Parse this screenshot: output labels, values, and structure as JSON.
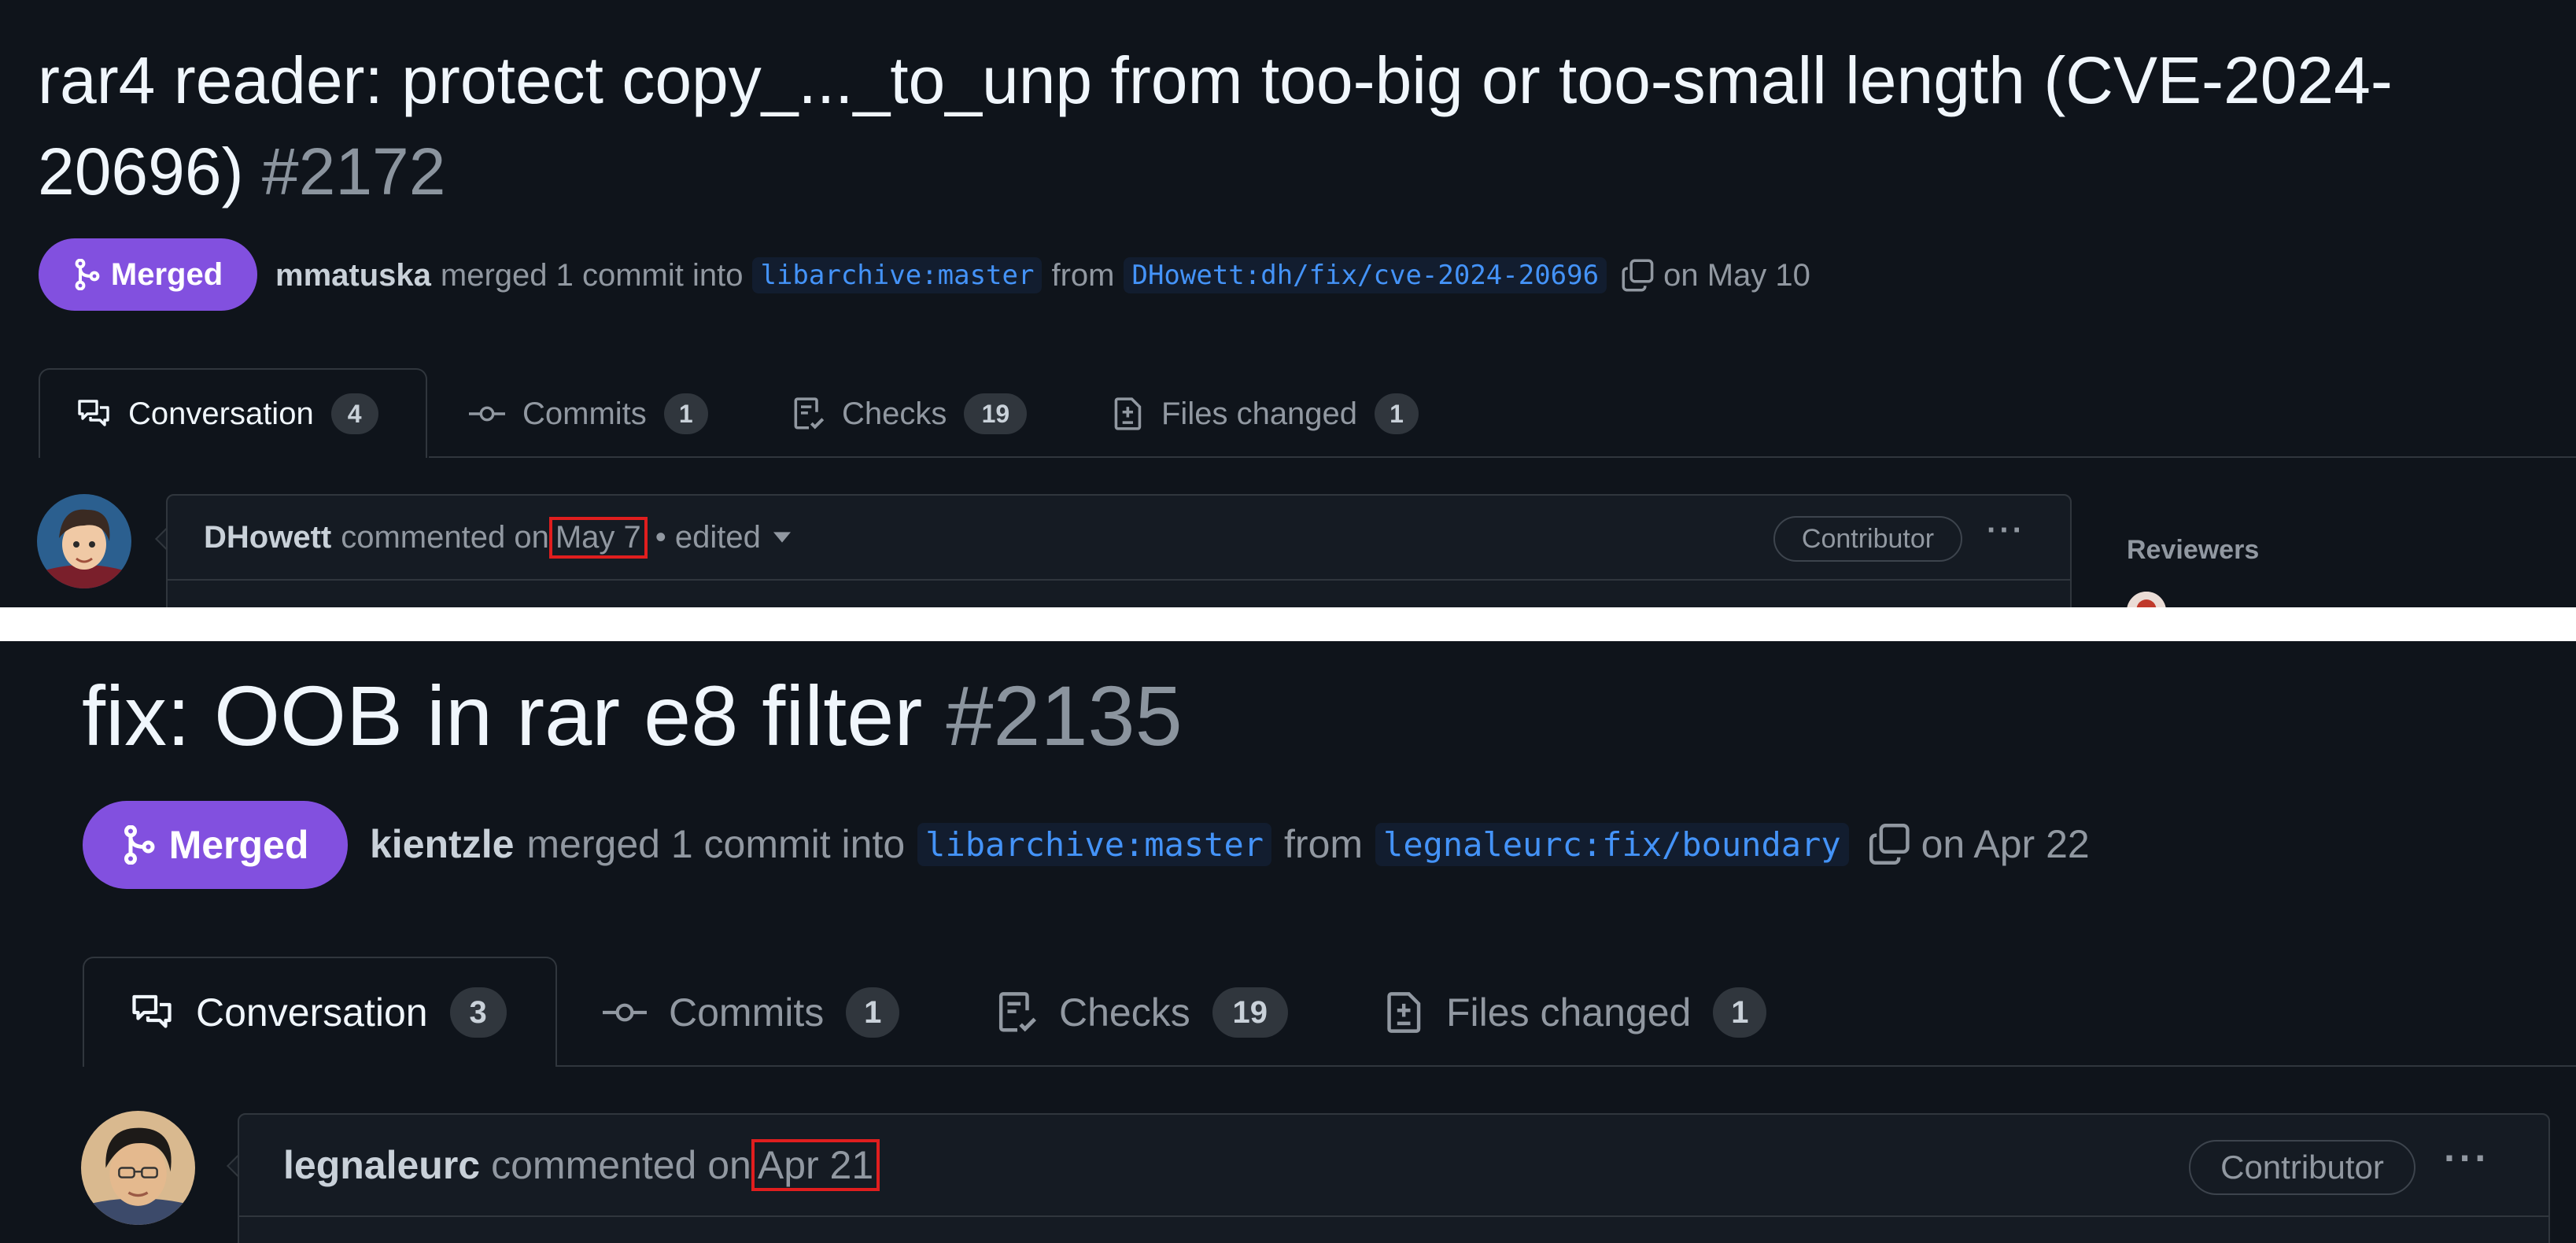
{
  "pr1": {
    "title_line1": "rar4 reader: protect copy_..._to_unp from too-big or too-small length (CVE-2024-",
    "title_line2": "20696)",
    "number": "#2172",
    "state": "Merged",
    "merger": "mmatuska",
    "merge_text": "merged 1 commit into",
    "base_branch": "libarchive:master",
    "from_text": "from",
    "head_branch": "DHowett:dh/fix/cve-2024-20696",
    "date": "on May 10",
    "tabs": [
      {
        "label": "Conversation",
        "count": "4"
      },
      {
        "label": "Commits",
        "count": "1"
      },
      {
        "label": "Checks",
        "count": "19"
      },
      {
        "label": "Files changed",
        "count": "1"
      }
    ],
    "comment": {
      "author": "DHowett",
      "action": "commented on",
      "date": "May 7",
      "edited": "• edited",
      "role": "Contributor",
      "more": "···"
    },
    "sidebar": {
      "reviewers_label": "Reviewers"
    }
  },
  "pr2": {
    "title": "fix: OOB in rar e8 filter",
    "number": "#2135",
    "state": "Merged",
    "merger": "kientzle",
    "merge_text": "merged 1 commit into",
    "base_branch": "libarchive:master",
    "from_text": "from",
    "head_branch": "legnaleurc:fix/boundary",
    "date": "on Apr 22",
    "tabs": [
      {
        "label": "Conversation",
        "count": "3"
      },
      {
        "label": "Commits",
        "count": "1"
      },
      {
        "label": "Checks",
        "count": "19"
      },
      {
        "label": "Files changed",
        "count": "1"
      }
    ],
    "comment": {
      "author": "legnaleurc",
      "action": "commented on",
      "date": "Apr 21",
      "role": "Contributor",
      "more": "···"
    }
  },
  "colors": {
    "background": "#0f141b",
    "merged_badge": "#8250df",
    "branch_text": "#4493f8",
    "highlight_box": "#e01e1e"
  },
  "icons": [
    "merge-icon",
    "copy-icon",
    "comment-discussion-icon",
    "commit-icon",
    "checklist-icon",
    "file-diff-icon",
    "caret-down-icon",
    "kebab-horizontal-icon"
  ]
}
